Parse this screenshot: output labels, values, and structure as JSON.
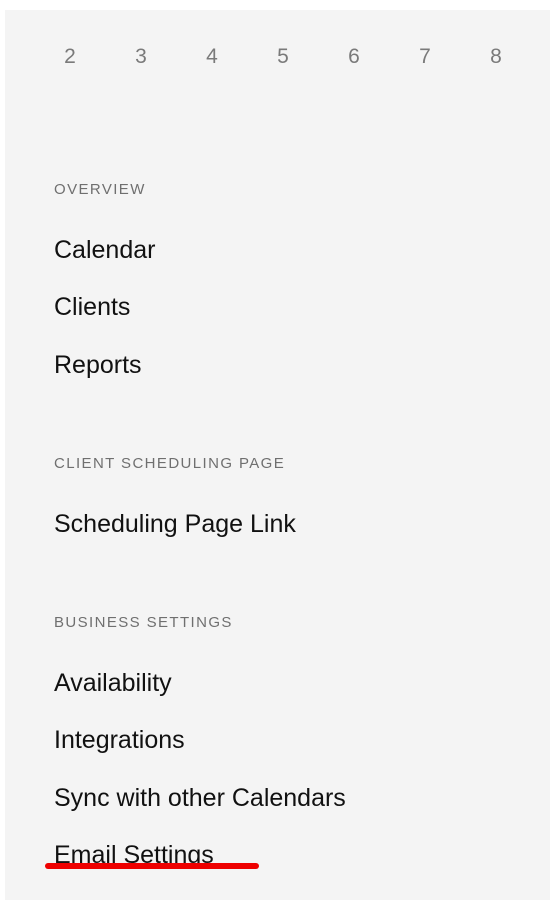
{
  "date_strip": {
    "days": [
      "2",
      "3",
      "4",
      "5",
      "6",
      "7",
      "8"
    ]
  },
  "sections": {
    "overview": {
      "heading": "OVERVIEW",
      "items": [
        "Calendar",
        "Clients",
        "Reports"
      ]
    },
    "client_scheduling_page": {
      "heading": "CLIENT SCHEDULING PAGE",
      "items": [
        "Scheduling Page Link"
      ]
    },
    "business_settings": {
      "heading": "BUSINESS SETTINGS",
      "items": [
        "Availability",
        "Integrations",
        "Sync with other Calendars",
        "Email Settings"
      ]
    }
  },
  "active_item": "Email Settings",
  "colors": {
    "panel_background": "#f4f4f4",
    "active_underline": "#ee0000",
    "heading_text": "#6f6f6f",
    "item_text": "#111111"
  }
}
